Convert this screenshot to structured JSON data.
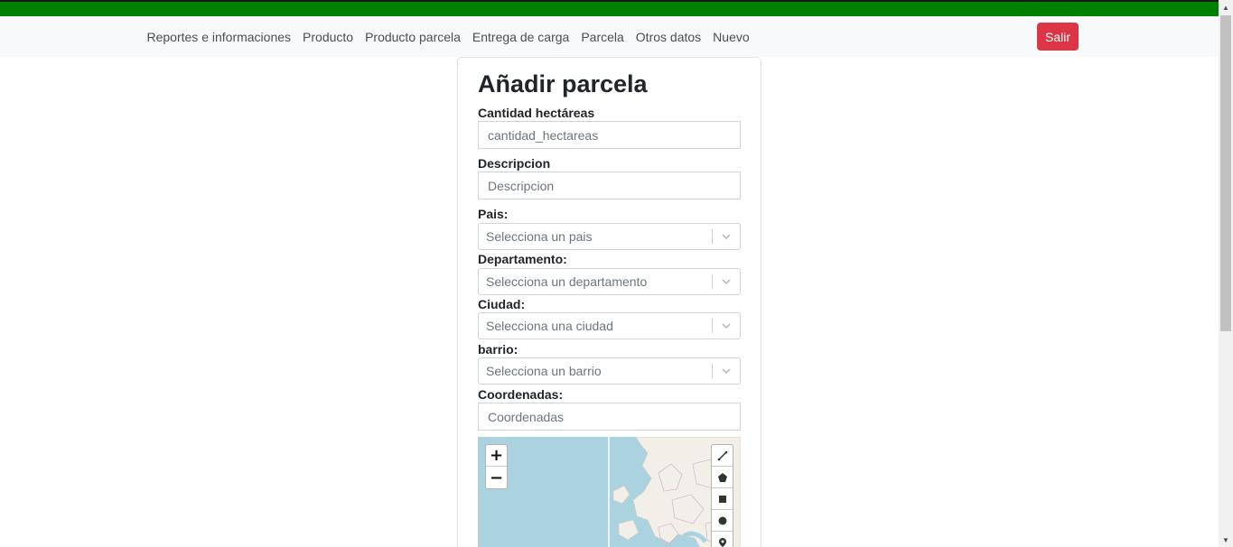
{
  "nav": {
    "links": [
      "Reportes e informaciones",
      "Producto",
      "Producto parcela",
      "Entrega de carga",
      "Parcela",
      "Otros datos",
      "Nuevo"
    ],
    "logout_label": "Salir"
  },
  "form": {
    "title": "Añadir parcela",
    "hectareas": {
      "label": "Cantidad hectáreas",
      "placeholder": "cantidad_hectareas"
    },
    "descripcion": {
      "label": "Descripcion",
      "placeholder": "Descripcion"
    },
    "pais": {
      "label": "Pais:",
      "placeholder": "Selecciona un pais"
    },
    "departamento": {
      "label": "Departamento:",
      "placeholder": "Selecciona un departamento"
    },
    "ciudad": {
      "label": "Ciudad:",
      "placeholder": "Selecciona una ciudad"
    },
    "barrio": {
      "label": "barrio:",
      "placeholder": "Selecciona un barrio"
    },
    "coordenadas": {
      "label": "Coordenadas:",
      "placeholder": "Coordenadas"
    }
  },
  "map": {
    "zoom_in": "+",
    "zoom_out": "−",
    "draw_tools": [
      "polyline-icon",
      "polygon-icon",
      "rectangle-icon",
      "circle-icon",
      "marker-icon"
    ]
  },
  "colors": {
    "topbar": "#008000",
    "navbar_bg": "#f8f9fa",
    "logout_button": "#dc3545",
    "map_water": "#aad3df",
    "map_land": "#f2efe9"
  }
}
